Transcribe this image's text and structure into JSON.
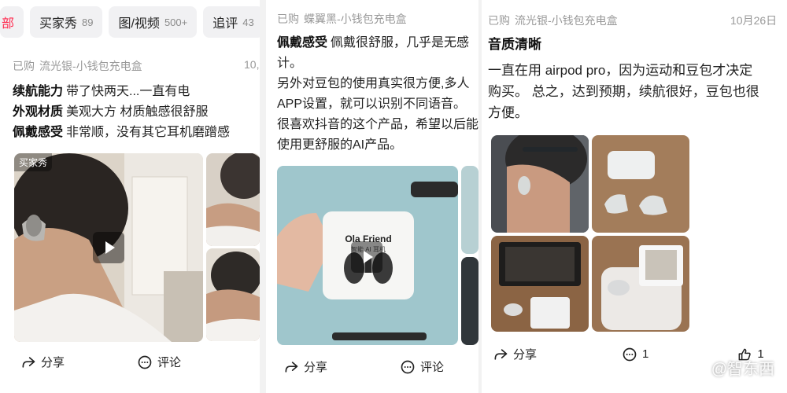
{
  "panel1": {
    "tabs": [
      {
        "label": "部",
        "count": ""
      },
      {
        "label": "买家秀",
        "count": "89"
      },
      {
        "label": "图/视频",
        "count": "500+"
      },
      {
        "label": "追评",
        "count": "43"
      }
    ],
    "review": {
      "purchased": "已购",
      "spec": "流光银-小钱包充电盒",
      "date": "10,",
      "lines": [
        {
          "title": "续航能力",
          "text": "带了快两天...一直有电"
        },
        {
          "title": "外观材质",
          "text": "美观大方 材质触感很舒服"
        },
        {
          "title": "佩戴感受",
          "text": "非常顺，没有其它耳机磨蹭感"
        }
      ],
      "media_badge": "买家秀",
      "share": "分享",
      "comment": "评论"
    }
  },
  "panel2": {
    "review": {
      "purchased": "已购",
      "spec": "蝶翼黑-小钱包充电盒",
      "lines": [
        {
          "title": "佩戴感受",
          "text": "佩戴很舒服，几乎是无感"
        },
        {
          "title": "",
          "text": "计。"
        },
        {
          "title": "",
          "text": "另外对豆包的使用真实很方便,多人"
        },
        {
          "title": "",
          "text": "APP设置，就可以识别不同语音。"
        },
        {
          "title": "",
          "text": "很喜欢抖音的这个产品，希望以后能"
        },
        {
          "title": "",
          "text": "使用更舒服的AI产品。"
        }
      ],
      "box_brand": "Ola Friend",
      "box_sub": "智能 AI 耳机",
      "share": "分享",
      "comment": "评论"
    }
  },
  "panel3": {
    "review": {
      "purchased": "已购",
      "spec": "流光银-小钱包充电盒",
      "date": "10月26日",
      "lines": [
        {
          "title": "音质清晰",
          "text": ""
        },
        {
          "title": "",
          "text": "一直在用 airpod pro，因为运动和豆包才决定"
        },
        {
          "title": "",
          "text": "购买。 总之，达到预期，续航很好，豆包也很"
        },
        {
          "title": "",
          "text": "方便。"
        }
      ],
      "share": "分享",
      "comment_count": "1",
      "like_count": "1"
    },
    "watermark": "@智东西"
  },
  "colors": {
    "accent": "#ff2a4f",
    "muted": "#999999"
  }
}
